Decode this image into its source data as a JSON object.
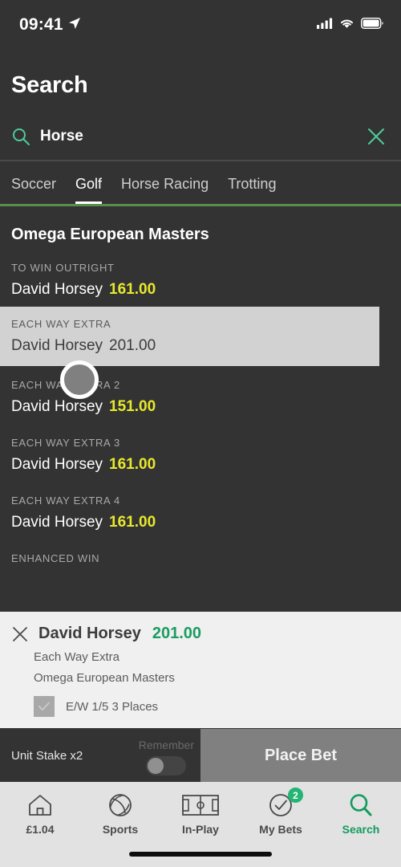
{
  "status_bar": {
    "time": "09:41",
    "location_icon": "location-arrow-icon",
    "signal_icon": "cellular-signal-icon",
    "wifi_icon": "wifi-icon",
    "battery_icon": "battery-icon"
  },
  "header": {
    "title": "Search"
  },
  "search": {
    "icon": "search-icon",
    "value": "Horse",
    "clear_icon": "close-icon"
  },
  "tabs": {
    "items": [
      {
        "label": "Soccer",
        "active": false
      },
      {
        "label": "Golf",
        "active": true
      },
      {
        "label": "Horse Racing",
        "active": false
      },
      {
        "label": "Trotting",
        "active": false
      }
    ],
    "underline_color": "#5a8c4a"
  },
  "market": {
    "title": "Omega European Masters",
    "rows": [
      {
        "label": "TO WIN OUTRIGHT",
        "selection": "David Horsey",
        "odds": "161.00",
        "selected": false
      },
      {
        "label": "EACH WAY EXTRA",
        "selection": "David Horsey",
        "odds": "201.00",
        "selected": true
      },
      {
        "label": "EACH WAY EXTRA 2",
        "selection": "David Horsey",
        "odds": "151.00",
        "selected": false
      },
      {
        "label": "EACH WAY EXTRA 3",
        "selection": "David Horsey",
        "odds": "161.00",
        "selected": false
      },
      {
        "label": "EACH WAY EXTRA 4",
        "selection": "David Horsey",
        "odds": "161.00",
        "selected": false
      },
      {
        "label": "ENHANCED WIN",
        "selection": "",
        "odds": "",
        "selected": false
      }
    ],
    "odds_color": "#e8e82e"
  },
  "betslip": {
    "close_icon": "close-icon",
    "name": "David Horsey",
    "odds": "201.00",
    "odds_color": "#1a9c62",
    "market": "Each Way Extra",
    "event": "Omega European Masters",
    "ew_checkbox_icon": "check-icon",
    "ew_label": "E/W 1/5  3 Places"
  },
  "action_bar": {
    "stake_label": "Unit Stake x2",
    "remember_label": "Remember",
    "remember_on": false,
    "place_bet_label": "Place Bet"
  },
  "bottom_nav": {
    "items": [
      {
        "label": "£1.04",
        "icon": "home-icon",
        "active": false,
        "badge": ""
      },
      {
        "label": "Sports",
        "icon": "ball-icon",
        "active": false,
        "badge": ""
      },
      {
        "label": "In-Play",
        "icon": "pitch-icon",
        "active": false,
        "badge": ""
      },
      {
        "label": "My Bets",
        "icon": "check-circle-icon",
        "active": false,
        "badge": "2"
      },
      {
        "label": "Search",
        "icon": "search-icon",
        "active": true,
        "badge": ""
      }
    ],
    "accent_color": "#119b5e"
  }
}
